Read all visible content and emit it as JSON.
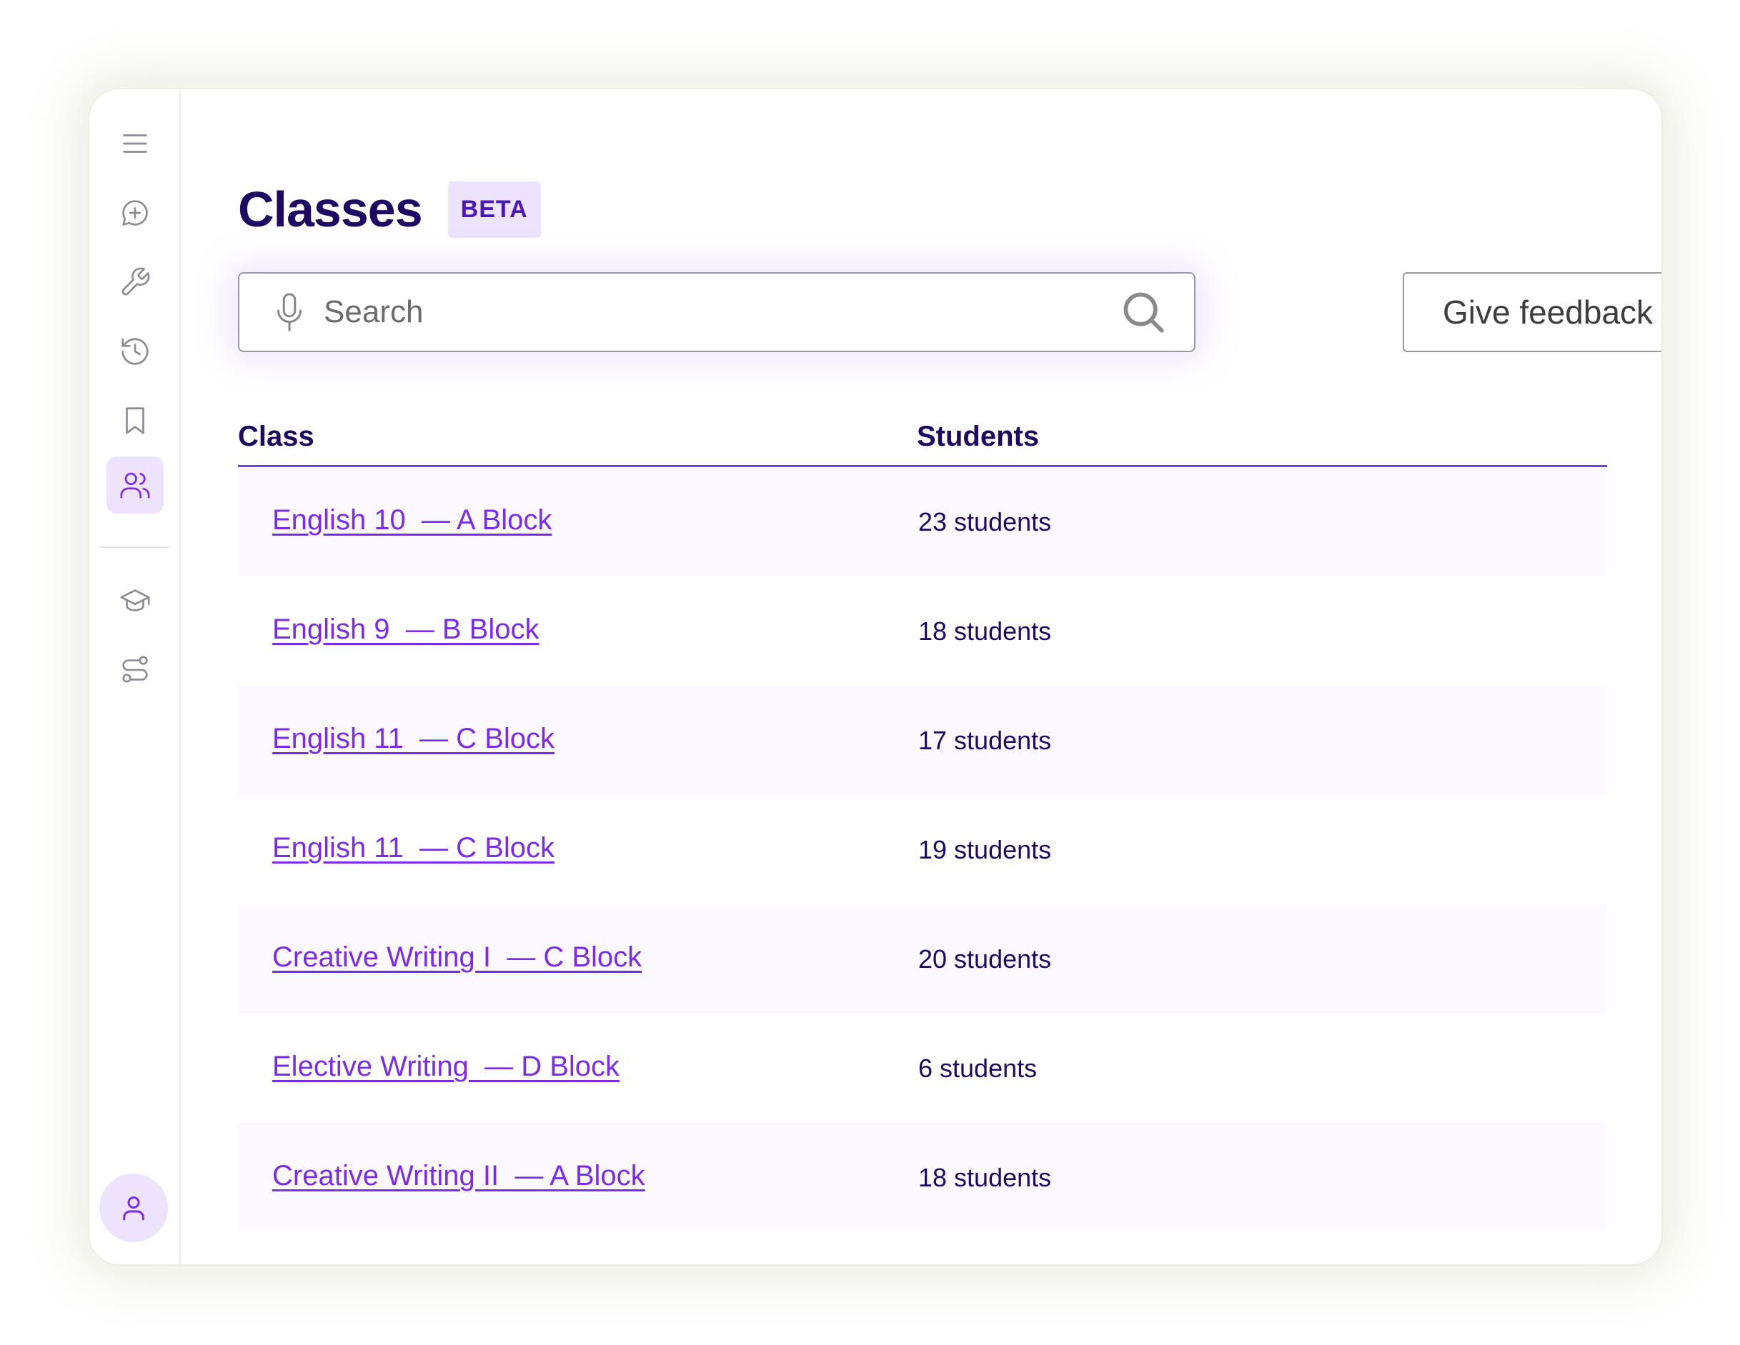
{
  "page": {
    "title": "Classes",
    "badge": "BETA"
  },
  "search": {
    "placeholder": "Search"
  },
  "feedback_button": {
    "label": "Give feedback"
  },
  "table": {
    "headers": {
      "class": "Class",
      "students": "Students"
    },
    "rows": [
      {
        "class": "English 10  — A Block",
        "students": "23 students"
      },
      {
        "class": "English 9  — B Block",
        "students": "18 students"
      },
      {
        "class": "English 11  — C Block",
        "students": "17 students"
      },
      {
        "class": "English 11  — C Block",
        "students": "19 students"
      },
      {
        "class": "Creative Writing I  — C Block",
        "students": "20 students"
      },
      {
        "class": "Elective Writing  — D Block",
        "students": "6 students"
      },
      {
        "class": "Creative Writing II  — A Block",
        "students": "18 students"
      }
    ]
  },
  "sidebar": {
    "items": [
      {
        "icon": "menu-icon"
      },
      {
        "icon": "new-chat-icon"
      },
      {
        "icon": "wrench-icon"
      },
      {
        "icon": "history-icon"
      },
      {
        "icon": "bookmark-icon"
      },
      {
        "icon": "users-icon",
        "active": true
      },
      {
        "icon": "graduation-cap-icon"
      },
      {
        "icon": "workflow-icon"
      }
    ],
    "avatar_icon": "user-icon"
  },
  "colors": {
    "accent": "#7a2ce9",
    "title": "#1f0a63",
    "badge_bg": "#ede3fc",
    "row_alt": "#fbf9ff",
    "sidebar_icon": "#8c8c96"
  }
}
